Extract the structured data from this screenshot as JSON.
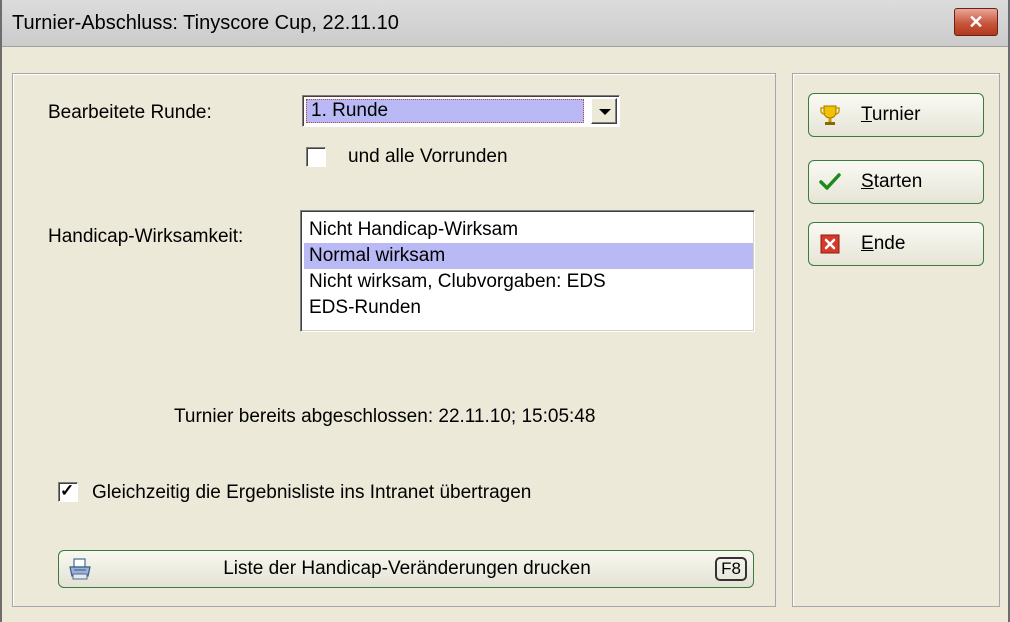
{
  "window": {
    "title": "Turnier-Abschluss: Tinyscore Cup, 22.11.10",
    "close_glyph": "✕"
  },
  "round": {
    "label": "Bearbeitete Runde:",
    "selected": "1. Runde",
    "include_previous_label": "und alle Vorrunden",
    "include_previous_checked": false
  },
  "handicap": {
    "label": "Handicap-Wirksamkeit:",
    "options": [
      "Nicht Handicap-Wirksam",
      "Normal wirksam",
      "Nicht wirksam, Clubvorgaben: EDS",
      "EDS-Runden"
    ],
    "selected_index": 1
  },
  "status_text": "Turnier bereits abgeschlossen: 22.11.10; 15:05:48",
  "intranet": {
    "label": "Gleichzeitig die Ergebnisliste ins Intranet übertragen",
    "checked": true
  },
  "print_button": {
    "label": "Liste der Handicap-Veränderungen drucken",
    "shortcut": "F8",
    "icon": "printer-icon"
  },
  "side_buttons": [
    {
      "hotkey": "T",
      "rest": "urnier",
      "icon": "trophy-icon"
    },
    {
      "hotkey": "S",
      "rest": "tarten",
      "icon": "checkmark-icon"
    },
    {
      "hotkey": "E",
      "rest": "nde",
      "icon": "red-x-icon"
    }
  ],
  "colors": {
    "selection": "#b9b9f5",
    "button_border": "#3d7a3d",
    "window_bg": "#ece9d8"
  }
}
